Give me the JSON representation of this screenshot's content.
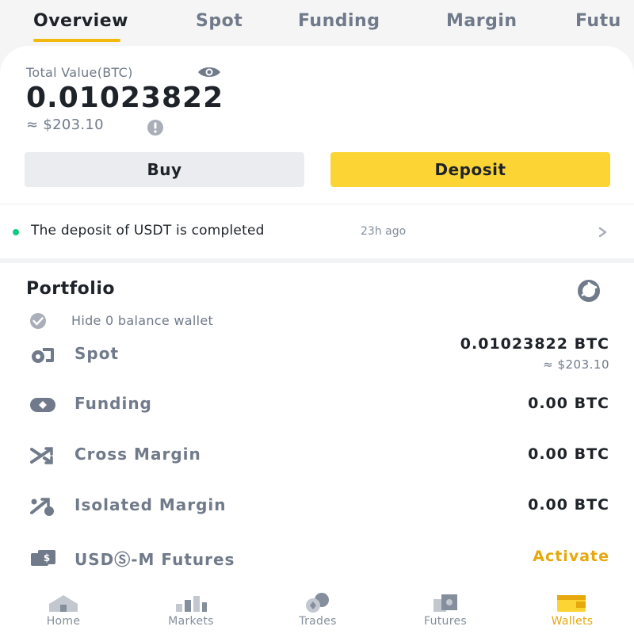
{
  "tabs": [
    {
      "label": "Overview",
      "active": true
    },
    {
      "label": "Spot"
    },
    {
      "label": "Funding"
    },
    {
      "label": "Margin"
    },
    {
      "label": "Futu"
    }
  ],
  "summary": {
    "total_label": "Total Value(BTC)",
    "total_btc": "0.01023822",
    "total_fiat": "≈ $203.10",
    "eye_icon": "eye-icon",
    "info_icon": "info-icon"
  },
  "actions": {
    "buy_label": "Buy",
    "deposit_label": "Deposit"
  },
  "notice": {
    "text": "The deposit of USDT is completed",
    "time": "23h ago",
    "dot_color": "#0ecb81"
  },
  "portfolio": {
    "title": "Portfolio",
    "hide_zero_label": "Hide 0 balance wallet",
    "wallets": [
      {
        "name": "Spot",
        "value": "0.01023822 BTC",
        "sub": "≈ $203.10",
        "icon": "spot-wallet-icon"
      },
      {
        "name": "Funding",
        "value": "0.00 BTC",
        "icon": "funding-wallet-icon"
      },
      {
        "name": "Cross Margin",
        "value": "0.00 BTC",
        "icon": "cross-margin-icon"
      },
      {
        "name": "Isolated Margin",
        "value": "0.00 BTC",
        "icon": "isolated-margin-icon"
      },
      {
        "name": "USDⓈ-M Futures",
        "value": "Activate",
        "icon": "usd-futures-icon"
      }
    ]
  },
  "bottom_nav": [
    {
      "label": "Home",
      "icon": "home-icon"
    },
    {
      "label": "Markets",
      "icon": "markets-icon"
    },
    {
      "label": "Trades",
      "icon": "trades-icon"
    },
    {
      "label": "Futures",
      "icon": "futures-icon"
    },
    {
      "label": "Wallets",
      "icon": "wallets-icon",
      "active": true
    }
  ],
  "colors": {
    "accent": "#fcd535",
    "active_text": "#e6a80c",
    "underline": "#f0b90b",
    "muted": "#707a8a"
  }
}
